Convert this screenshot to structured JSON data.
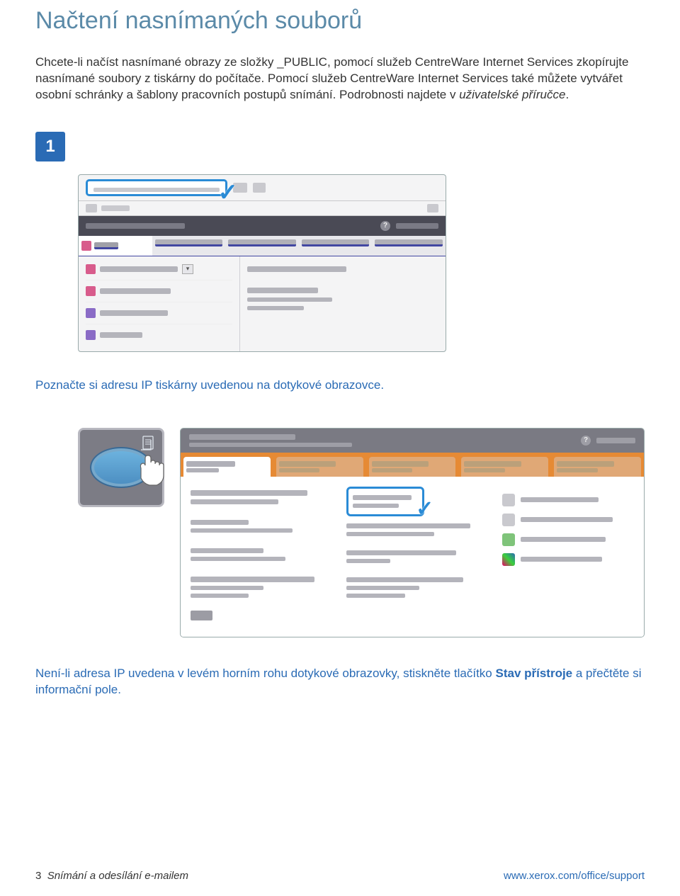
{
  "title": "Načtení nasnímaných souborů",
  "intro_part1": "Chcete-li načíst nasnímané obrazy ze složky _PUBLIC, pomocí služeb CentreWare Internet Services zkopírujte nasnímané soubory z tiskárny do počítače. Pomocí služeb CentreWare Internet Services také můžete vytvářet osobní schránky a šablony pracovních postupů snímání. Podrobnosti najdete v ",
  "intro_part2_italic": "uživatelské příručce",
  "intro_part3": ".",
  "step_number": "1",
  "caption1": "Poznačte si adresu IP tiskárny uvedenou na dotykové obrazovce.",
  "caption2_a": "Není-li adresa IP uvedena v levém horním rohu dotykové obrazovky, stiskněte tlačítko ",
  "caption2_b_bold": "Stav přístroje",
  "caption2_c": " a přečtěte si informační pole.",
  "footer_left_page": "3",
  "footer_left_text": "Snímání a odesílání e-mailem",
  "footer_right": "www.xerox.com/office/support"
}
